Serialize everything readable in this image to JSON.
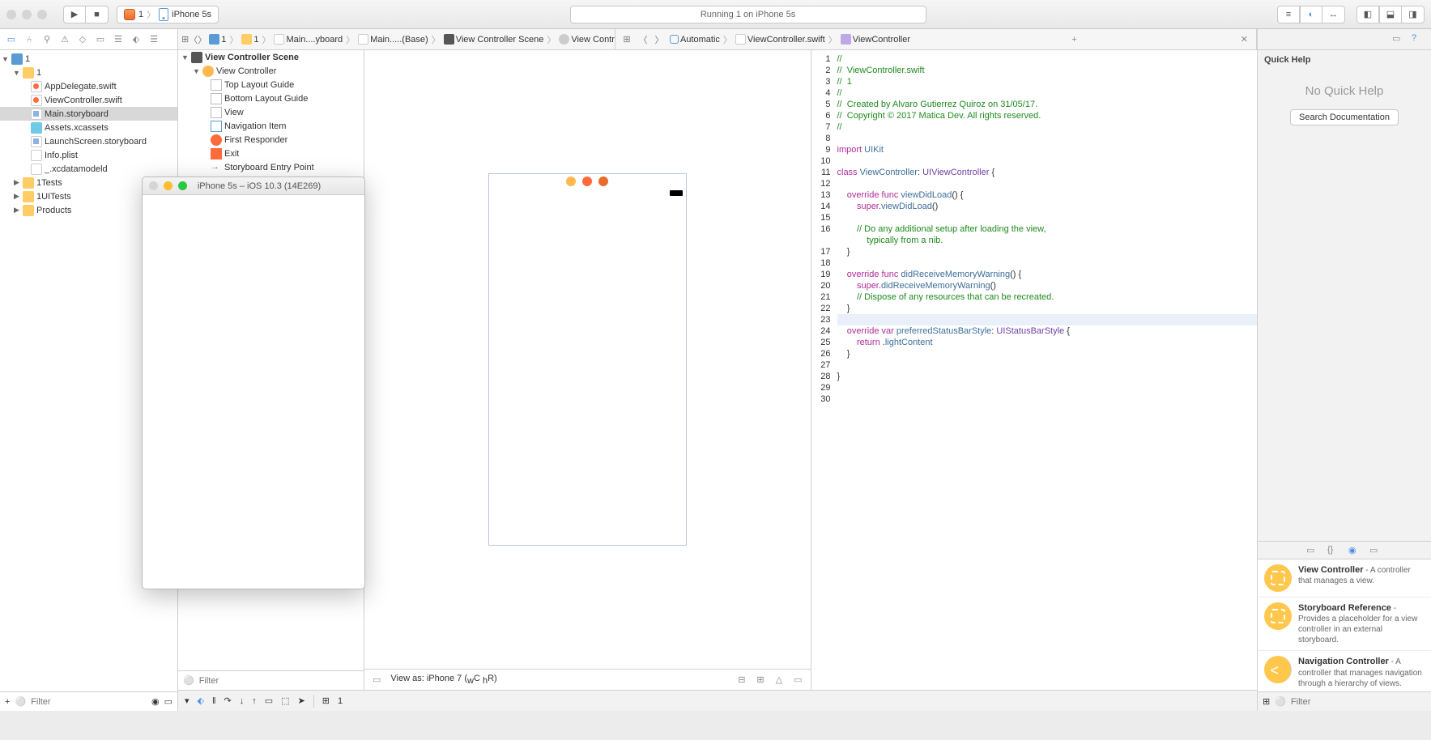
{
  "toolbar": {
    "scheme_name": "1",
    "scheme_dest": "iPhone 5s",
    "status": "Running 1 on iPhone 5s"
  },
  "navigator": {
    "root": "1",
    "group": "1",
    "items": [
      "AppDelegate.swift",
      "ViewController.swift",
      "Main.storyboard",
      "Assets.xcassets",
      "LaunchScreen.storyboard",
      "Info.plist",
      "_.xcdatamodeld"
    ],
    "folders": [
      "1Tests",
      "1UITests",
      "Products"
    ],
    "filter_placeholder": "Filter"
  },
  "outline": {
    "scene": "View Controller Scene",
    "vc": "View Controller",
    "items": [
      "Top Layout Guide",
      "Bottom Layout Guide",
      "View",
      "Navigation Item"
    ],
    "fr": "First Responder",
    "exit": "Exit",
    "entry": "Storyboard Entry Point",
    "filter_placeholder": "Filter"
  },
  "jumpbar": {
    "left": [
      "1",
      "1",
      "Main....yboard",
      "Main.....(Base)",
      "View Controller Scene",
      "View Controller"
    ],
    "right_mode": "Automatic",
    "right_file": "ViewController.swift",
    "right_symbol": "ViewController"
  },
  "canvas": {
    "view_as": "View as: iPhone 7 (",
    "view_as_suffix": "C",
    "view_as_suffix2": "R)",
    "w": "w",
    "h": "h"
  },
  "code": {
    "lines": [
      {
        "t": "//",
        "cls": "c-comment"
      },
      {
        "t": "//  ViewController.swift",
        "cls": "c-comment"
      },
      {
        "t": "//  1",
        "cls": "c-comment"
      },
      {
        "t": "//",
        "cls": "c-comment"
      },
      {
        "t": "//  Created by Alvaro Gutierrez Quiroz on 31/05/17.",
        "cls": "c-comment"
      },
      {
        "t": "//  Copyright © 2017 Matica Dev. All rights reserved.",
        "cls": "c-comment"
      },
      {
        "t": "//",
        "cls": "c-comment"
      },
      {
        "t": "",
        "cls": ""
      },
      {
        "html": "<span class='c-keyword'>import</span> <span class='c-ident'>UIKit</span>"
      },
      {
        "t": "",
        "cls": ""
      },
      {
        "html": "<span class='c-keyword'>class</span> <span class='c-ident'>ViewController</span>: <span class='c-type'>UIViewController</span> {"
      },
      {
        "t": "",
        "cls": ""
      },
      {
        "html": "    <span class='c-keyword'>override</span> <span class='c-keyword'>func</span> <span class='c-func'>viewDidLoad</span>() {"
      },
      {
        "html": "        <span class='c-keyword'>super</span>.<span class='c-func'>viewDidLoad</span>()"
      },
      {
        "t": "",
        "cls": ""
      },
      {
        "html": "        <span class='c-comment'>// Do any additional setup after loading the view,</span>"
      },
      {
        "html": "            <span class='c-comment'>typically from a nib.</span>",
        "extra": true
      },
      {
        "t": "    }",
        "cls": ""
      },
      {
        "t": "",
        "cls": ""
      },
      {
        "html": "    <span class='c-keyword'>override</span> <span class='c-keyword'>func</span> <span class='c-func'>didReceiveMemoryWarning</span>() {"
      },
      {
        "html": "        <span class='c-keyword'>super</span>.<span class='c-func'>didReceiveMemoryWarning</span>()"
      },
      {
        "html": "        <span class='c-comment'>// Dispose of any resources that can be recreated.</span>"
      },
      {
        "t": "    }",
        "cls": ""
      },
      {
        "t": "    ",
        "cls": "",
        "hl": true
      },
      {
        "html": "    <span class='c-keyword'>override</span> <span class='c-keyword'>var</span> <span class='c-ident'>preferredStatusBarStyle</span>: <span class='c-type'>UIStatusBarStyle</span> {"
      },
      {
        "html": "        <span class='c-keyword'>return</span> .<span class='c-ident'>lightContent</span>"
      },
      {
        "t": "    }",
        "cls": ""
      },
      {
        "t": "",
        "cls": ""
      },
      {
        "t": "}",
        "cls": ""
      },
      {
        "t": "",
        "cls": ""
      },
      {
        "t": "",
        "cls": ""
      }
    ]
  },
  "simulator": {
    "title": "iPhone 5s – iOS 10.3 (14E269)"
  },
  "inspector": {
    "title": "Quick Help",
    "no_help": "No Quick Help",
    "search_btn": "Search Documentation"
  },
  "library": {
    "items": [
      {
        "name": "View Controller",
        "desc": " - A controller that manages a view."
      },
      {
        "name": "Storyboard Reference",
        "desc": " - Provides a placeholder for a view controller in an external storyboard."
      },
      {
        "name": "Navigation Controller",
        "desc": " - A controller that manages navigation through a hierarchy of views."
      }
    ],
    "filter_placeholder": "Filter"
  },
  "debug": {
    "breakpoint_count": "1"
  }
}
